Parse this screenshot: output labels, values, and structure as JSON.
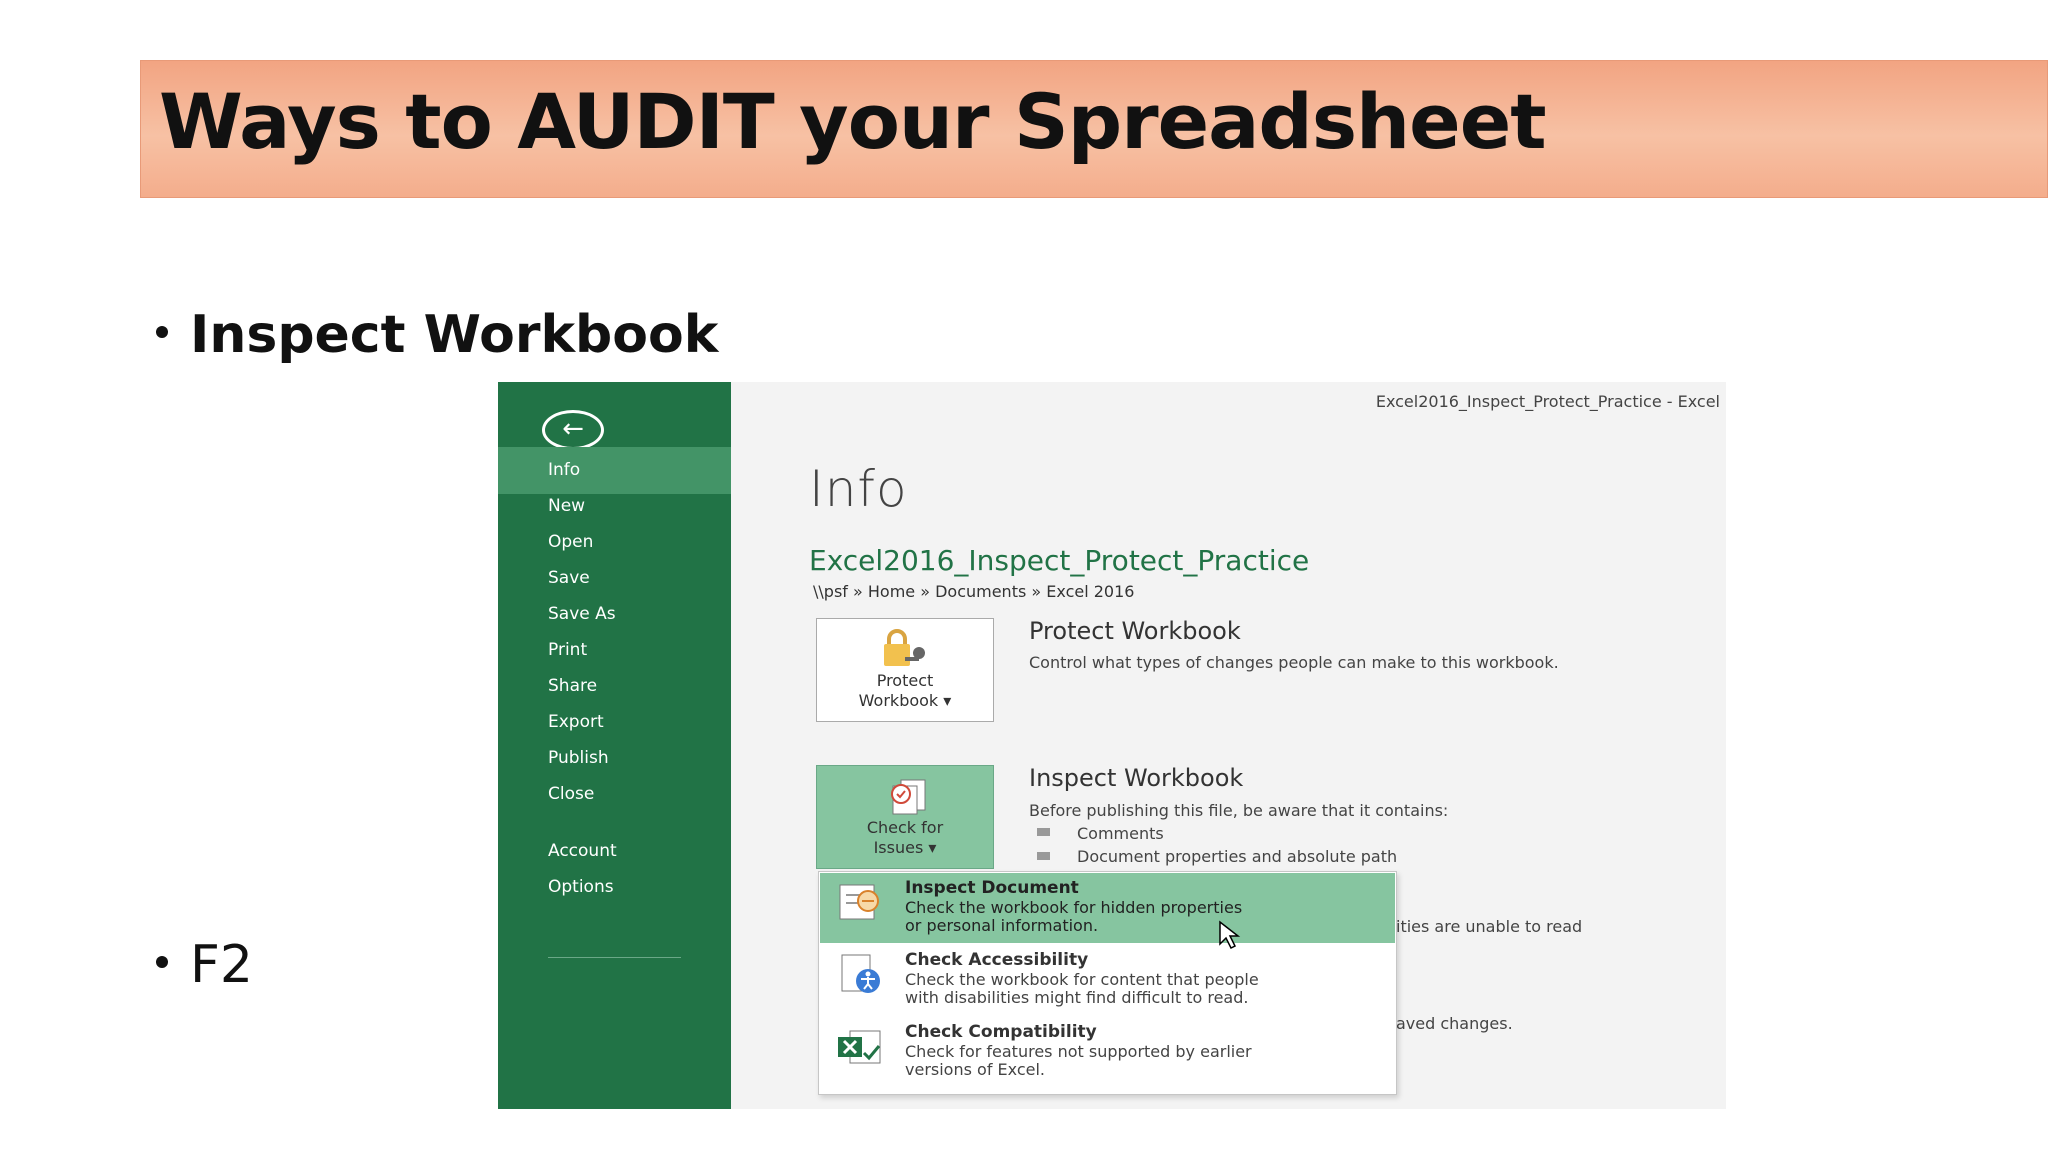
{
  "slide": {
    "title": "Ways to AUDIT your Spreadsheet",
    "bullets": [
      "Inspect Workbook",
      "F2"
    ]
  },
  "excel": {
    "window_title": "Excel2016_Inspect_Protect_Practice - Excel",
    "accent_color": "#217346",
    "nav": [
      "Info",
      "New",
      "Open",
      "Save",
      "Save As",
      "Print",
      "Share",
      "Export",
      "Publish",
      "Close",
      "Account",
      "Options"
    ],
    "active_nav": "Info",
    "page_title": "Info",
    "file_name": "Excel2016_Inspect_Protect_Practice",
    "file_path": "\\\\psf » Home » Documents » Excel 2016",
    "protect": {
      "tile_line1": "Protect",
      "tile_line2": "Workbook ▾",
      "heading": "Protect Workbook",
      "desc": "Control what types of changes people can make to this workbook."
    },
    "inspect": {
      "tile_line1": "Check for",
      "tile_line2": "Issues ▾",
      "heading": "Inspect Workbook",
      "desc": "Before publishing this file, be aware that it contains:",
      "items": [
        "Comments",
        "Document properties and absolute path"
      ],
      "partial1": "ities are unable to read",
      "partial2": "aved changes."
    },
    "menu": [
      {
        "title": "Inspect Document",
        "d1": "Check the workbook for hidden properties",
        "d2": "or personal information."
      },
      {
        "title": "Check Accessibility",
        "d1": "Check the workbook for content that people",
        "d2": "with disabilities might find difficult to read."
      },
      {
        "title": "Check Compatibility",
        "d1": "Check for features not supported by earlier",
        "d2": "versions of Excel."
      }
    ]
  }
}
